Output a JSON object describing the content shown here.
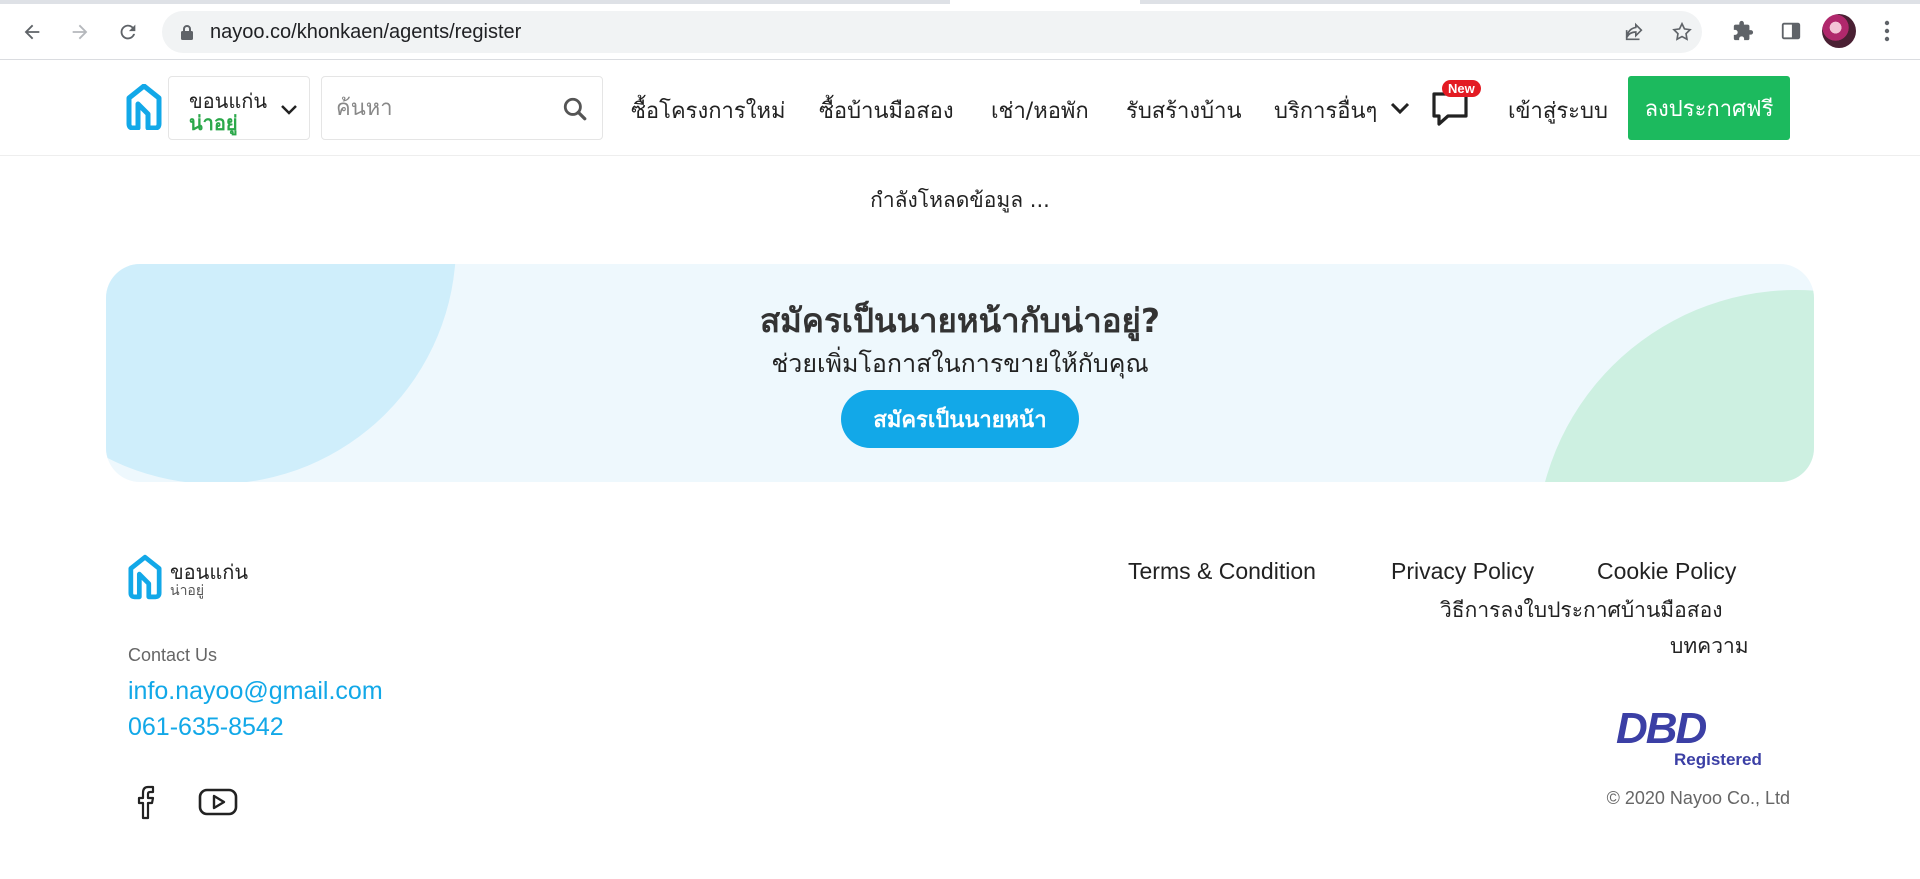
{
  "browser": {
    "url": "nayoo.co/khonkaen/agents/register"
  },
  "header": {
    "city_line1": "ขอนแก่น",
    "city_line2": "น่าอยู่",
    "search_placeholder": "ค้นหา",
    "nav": [
      "ซื้อโครงการใหม่",
      "ซื้อบ้านมือสอง",
      "เช่า/หอพัก",
      "รับสร้างบ้าน",
      "บริการอื่นๆ"
    ],
    "new_badge": "New",
    "login": "เข้าสู่ระบบ",
    "post_free": "ลงประกาศฟรี"
  },
  "main": {
    "loading": "กำลังโหลดข้อมูล ..."
  },
  "banner": {
    "title": "สมัครเป็นนายหน้ากับน่าอยู่?",
    "subtitle": "ช่วยเพิ่มโอกาสในการขายให้กับคุณ",
    "cta": "สมัครเป็นนายหน้า"
  },
  "footer": {
    "brand_line1": "ขอนแก่น",
    "brand_line2": "น่าอยู่",
    "contact_label": "Contact Us",
    "email": "info.nayoo@gmail.com",
    "phone": "061-635-8542",
    "links": {
      "terms": "Terms & Condition",
      "privacy": "Privacy Policy",
      "cookie": "Cookie Policy",
      "howto": "วิธีการลงใบประกาศบ้านมือสอง",
      "articles": "บทความ"
    },
    "dbd_mark": "DBD",
    "dbd_registered": "Registered",
    "copyright": "© 2020 Nayoo Co., Ltd"
  },
  "colors": {
    "brand_blue": "#12a8e8",
    "brand_green": "#1cba5e",
    "badge_red": "#e31b23"
  }
}
